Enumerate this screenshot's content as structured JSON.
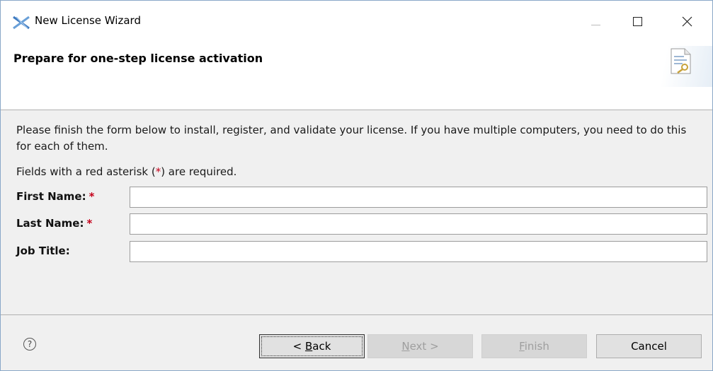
{
  "window": {
    "title": "New License Wizard",
    "icon": "x-cross-icon"
  },
  "header": {
    "title": "Prepare for one-step license activation",
    "image": "license-document-key-icon"
  },
  "intro_text": "Please finish the form below to install, register, and validate your license. If you have multiple computers, you need to do this for each of them.",
  "required_note": {
    "prefix": "Fields with a red asterisk (",
    "asterisk": "*",
    "suffix": ") are required."
  },
  "form": {
    "first_name": {
      "label": "First Name:",
      "required_mark": "*",
      "value": ""
    },
    "last_name": {
      "label": "Last Name:",
      "required_mark": "*",
      "value": ""
    },
    "job_title": {
      "label": "Job Title:",
      "value": ""
    }
  },
  "footer": {
    "help": "?",
    "back": {
      "mnemonic_prefix": "< ",
      "mnemonic": "B",
      "rest": "ack"
    },
    "next": {
      "mnemonic": "N",
      "rest": "ext >"
    },
    "finish": {
      "mnemonic": "F",
      "rest": "inish"
    },
    "cancel": "Cancel"
  },
  "colors": {
    "required": "#c4001a",
    "disabled_text": "#9e9e9e",
    "window_border": "#8aa8c8"
  }
}
